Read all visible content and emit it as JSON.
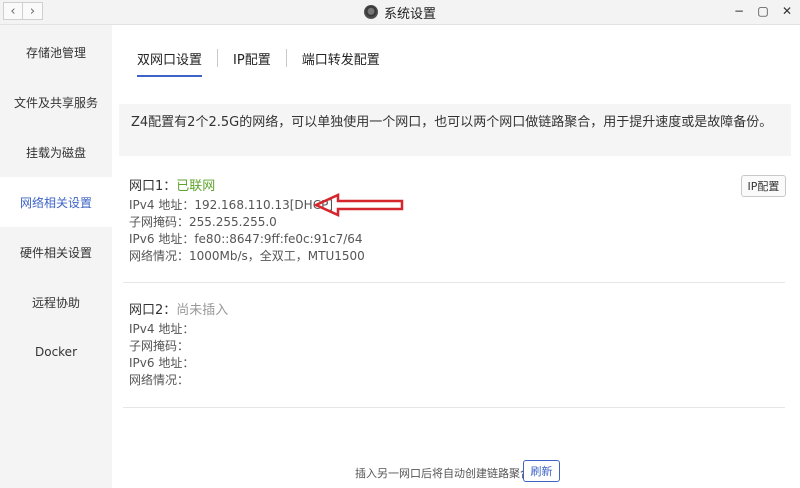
{
  "window": {
    "title": "系统设置",
    "back_icon": "‹",
    "forward_icon": "›",
    "minimize_icon": "−",
    "maximize_icon": "▢",
    "close_icon": "✕"
  },
  "sidebar": {
    "items": [
      {
        "label": "存储池管理"
      },
      {
        "label": "文件及共享服务"
      },
      {
        "label": "挂载为磁盘"
      },
      {
        "label": "网络相关设置"
      },
      {
        "label": "硬件相关设置"
      },
      {
        "label": "远程协助"
      },
      {
        "label": "Docker"
      }
    ],
    "active_index": 3
  },
  "tabs": [
    {
      "label": "双网口设置"
    },
    {
      "label": "IP配置"
    },
    {
      "label": "端口转发配置"
    }
  ],
  "info_text": "Z4配置有2个2.5G的网络，可以单独使用一个网口，也可以两个网口做链路聚合，用于提升速度或是故障备份。",
  "port1": {
    "label": "网口1：",
    "status": "已联网",
    "ipv4": "IPv4 地址：192.168.110.13[DHCP]",
    "mask": "子网掩码：255.255.255.0",
    "ipv6": "IPv6 地址：fe80::8647:9ff:fe0c:91c7/64",
    "net": "网络情况：1000Mb/s，全双工，MTU1500",
    "ip_button": "IP配置"
  },
  "port2": {
    "label": "网口2：",
    "status": "尚未插入",
    "ipv4": "IPv4 地址：",
    "mask": "子网掩码：",
    "ipv6": "IPv6 地址：",
    "net": "网络情况："
  },
  "footer": {
    "hint": "插入另一网口后将自动创建链路聚合",
    "refresh": "刷新"
  },
  "colors": {
    "accent": "#3e64c7",
    "status_ok": "#5fa32c",
    "annotation_arrow": "#d6262d"
  }
}
